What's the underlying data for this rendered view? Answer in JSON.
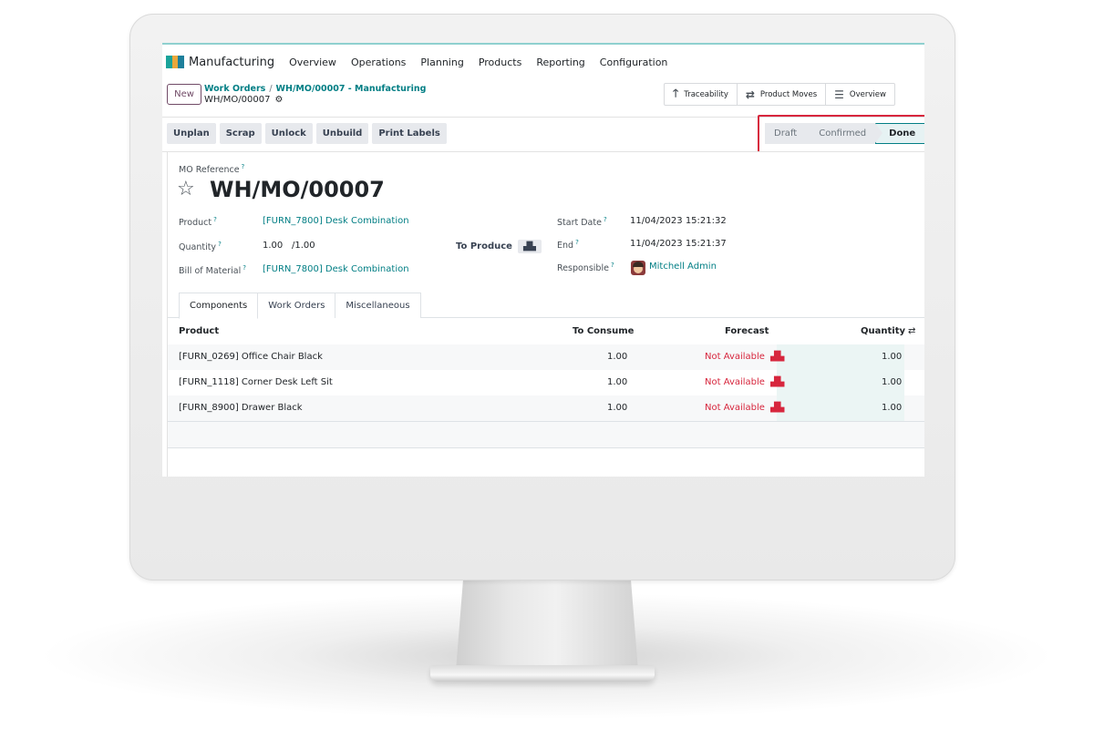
{
  "navbar": {
    "app_name": "Manufacturing",
    "menu": [
      "Overview",
      "Operations",
      "Planning",
      "Products",
      "Reporting",
      "Configuration"
    ]
  },
  "control": {
    "new_label": "New",
    "breadcrumb_parent": "Work Orders",
    "breadcrumb_separator": "/",
    "breadcrumb_current": "WH/MO/00007 - Manufacturing",
    "record_name": "WH/MO/00007",
    "smart_buttons": [
      {
        "icon": "up-arrow-icon",
        "glyph": "🡑",
        "label": "Traceability"
      },
      {
        "icon": "swap-arrows-icon",
        "glyph": "⇄",
        "label": "Product Moves"
      },
      {
        "icon": "list-icon",
        "glyph": "☰",
        "label": "Overview"
      }
    ]
  },
  "actions": [
    "Unplan",
    "Scrap",
    "Unlock",
    "Unbuild",
    "Print Labels"
  ],
  "status": {
    "stages": [
      "Draft",
      "Confirmed",
      "Done"
    ],
    "current": "Done"
  },
  "form": {
    "mo_reference_label": "MO Reference",
    "mo_reference": "WH/MO/00007",
    "product_label": "Product",
    "product_value": "[FURN_7800] Desk Combination",
    "quantity_label": "Quantity",
    "quantity_value": "1.00",
    "quantity_total": "/1.00",
    "to_produce_label": "To Produce",
    "bom_label": "Bill of Material",
    "bom_value": "[FURN_7800] Desk Combination",
    "start_date_label": "Start Date",
    "start_date_value": "11/04/2023 15:21:32",
    "end_label": "End",
    "end_value": "11/04/2023 15:21:37",
    "responsible_label": "Responsible",
    "responsible_value": "Mitchell Admin",
    "help_mark": "?"
  },
  "tabs": [
    "Components",
    "Work Orders",
    "Miscellaneous"
  ],
  "table": {
    "headers": {
      "product": "Product",
      "to_consume": "To Consume",
      "forecast": "Forecast",
      "quantity": "Quantity"
    },
    "rows": [
      {
        "product": "[FURN_0269] Office Chair Black",
        "to_consume": "1.00",
        "forecast": "Not Available",
        "quantity": "1.00"
      },
      {
        "product": "[FURN_1118] Corner Desk Left Sit",
        "to_consume": "1.00",
        "forecast": "Not Available",
        "quantity": "1.00"
      },
      {
        "product": "[FURN_8900] Drawer Black",
        "to_consume": "1.00",
        "forecast": "Not Available",
        "quantity": "1.00"
      }
    ]
  },
  "colors": {
    "brand": "#714b67",
    "link": "#017e84",
    "warning": "#d7263d",
    "highlight_box": "#d7263d"
  }
}
